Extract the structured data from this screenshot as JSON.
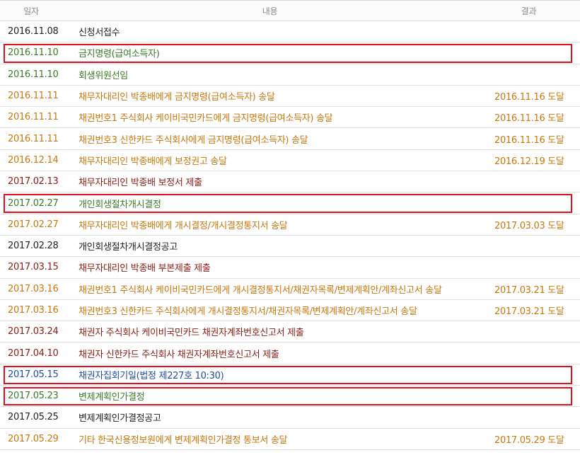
{
  "header": {
    "date": "일자",
    "content": "내용",
    "result": "결과"
  },
  "colors": {
    "black": "#222222",
    "green": "#3b7a2a",
    "orange": "#c8770d",
    "maroon": "#8c1c12",
    "blue": "#1f4fa0",
    "highlight": "#e0101f"
  },
  "rows": [
    {
      "date": "2016.11.08",
      "content": "신청서접수",
      "result": "",
      "color": "#222222",
      "highlight": false
    },
    {
      "date": "2016.11.10",
      "content": "금지명령(급여소득자)",
      "result": "",
      "color": "#3b7a2a",
      "highlight": true
    },
    {
      "date": "2016.11.10",
      "content": "회생위원선임",
      "result": "",
      "color": "#3b7a2a",
      "highlight": false
    },
    {
      "date": "2016.11.11",
      "content": "채무자대리인 박종배에게 금지명령(급여소득자) 송달",
      "result": "2016.11.16 도달",
      "color": "#c8770d",
      "highlight": false
    },
    {
      "date": "2016.11.11",
      "content": "채권번호1 주식회사 케이비국민카드에게 금지명령(급여소득자) 송달",
      "result": "2016.11.16 도달",
      "color": "#c8770d",
      "highlight": false
    },
    {
      "date": "2016.11.11",
      "content": "채권번호3 신한카드 주식회사에게 금지명령(급여소득자) 송달",
      "result": "2016.11.16 도달",
      "color": "#c8770d",
      "highlight": false
    },
    {
      "date": "2016.12.14",
      "content": "채무자대리인 박종배에게 보정권고 송달",
      "result": "2016.12.19 도달",
      "color": "#c8770d",
      "highlight": false
    },
    {
      "date": "2017.02.13",
      "content": "채무자대리인 박종배 보정서 제출",
      "result": "",
      "color": "#8c1c12",
      "highlight": false
    },
    {
      "date": "2017.02.27",
      "content": "개인회생절차개시결정",
      "result": "",
      "color": "#3b7a2a",
      "highlight": true
    },
    {
      "date": "2017.02.27",
      "content": "채무자대리인 박종배에게 개시결정/개시결정통지서 송달",
      "result": "2017.03.03 도달",
      "color": "#c8770d",
      "highlight": false
    },
    {
      "date": "2017.02.28",
      "content": "개인회생절차개시결정공고",
      "result": "",
      "color": "#222222",
      "highlight": false
    },
    {
      "date": "2017.03.15",
      "content": "채무자대리인 박종배 부본제출 제출",
      "result": "",
      "color": "#8c1c12",
      "highlight": false
    },
    {
      "date": "2017.03.16",
      "content": "채권번호1 주식회사 케이비국민카드에게 개시결정통지서/채권자목록/변제계획안/계좌신고서 송달",
      "result": "2017.03.21 도달",
      "color": "#c8770d",
      "highlight": false
    },
    {
      "date": "2017.03.16",
      "content": "채권번호3 신한카드 주식회사에게 개시결정통지서/채권자목록/변제계획안/계좌신고서 송달",
      "result": "2017.03.21 도달",
      "color": "#c8770d",
      "highlight": false
    },
    {
      "date": "2017.03.24",
      "content": "채권자 주식회사 케이비국민카드 채권자계좌번호신고서 제출",
      "result": "",
      "color": "#8c1c12",
      "highlight": false
    },
    {
      "date": "2017.04.10",
      "content": "채권자 신한카드 주식회사 채권자계좌번호신고서 제출",
      "result": "",
      "color": "#8c1c12",
      "highlight": false
    },
    {
      "date": "2017.05.15",
      "content": "채권자집회기일(법정 제227호 10:30)",
      "result": "",
      "color": "#1f4fa0",
      "highlight": true
    },
    {
      "date": "2017.05.23",
      "content": "변제계획인가결정",
      "result": "",
      "color": "#3b7a2a",
      "highlight": true
    },
    {
      "date": "2017.05.25",
      "content": "변제계획인가결정공고",
      "result": "",
      "color": "#222222",
      "highlight": false
    },
    {
      "date": "2017.05.29",
      "content": "기타 한국신용정보원에게 변제계획인가결정 통보서 송달",
      "result": "2017.05.29 도달",
      "color": "#c8770d",
      "highlight": false
    }
  ]
}
